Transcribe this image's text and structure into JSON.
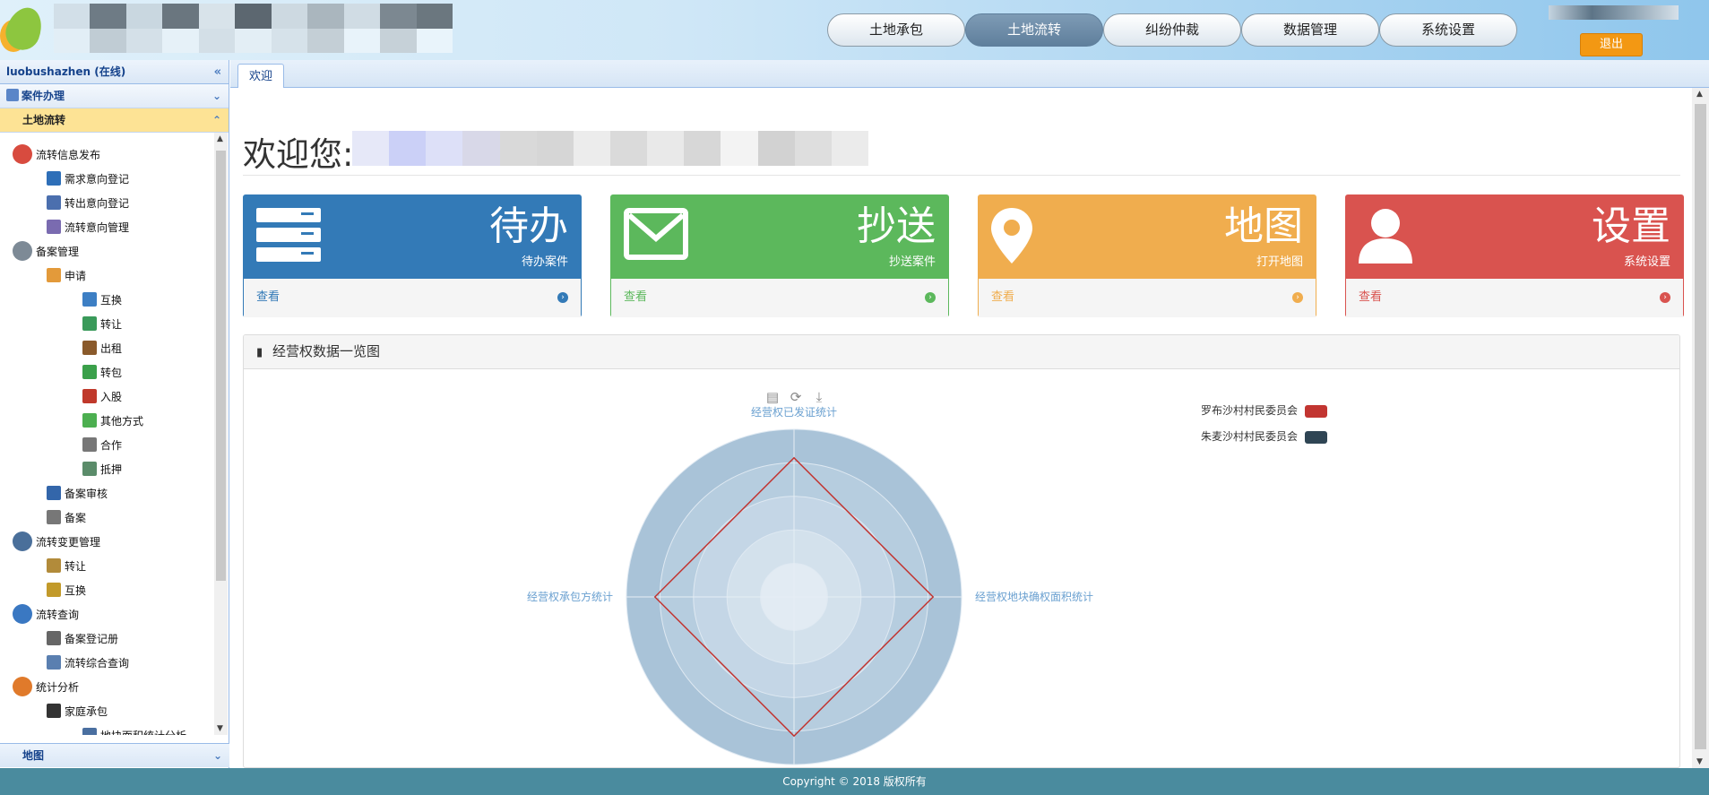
{
  "nav": {
    "items": [
      "土地承包",
      "土地流转",
      "纠纷仲裁",
      "数据管理",
      "系统设置"
    ],
    "active": 1
  },
  "header": {
    "logout_label": "退出"
  },
  "sidebar": {
    "user_label": "luobushazhen (在线)",
    "section1": "案件办理",
    "section2": "土地流转",
    "bottom": "地图",
    "tree": [
      {
        "label": "流转信息发布",
        "level": 0,
        "icon": "publish-icon",
        "color": "#d84b3f"
      },
      {
        "label": "需求意向登记",
        "level": 1,
        "icon": "arrow-left-icon",
        "color": "#2e6fb8"
      },
      {
        "label": "转出意向登记",
        "level": 1,
        "icon": "transfer-out-icon",
        "color": "#4b6fae"
      },
      {
        "label": "流转意向管理",
        "level": 1,
        "icon": "manage-icon",
        "color": "#7a6bb0"
      },
      {
        "label": "备案管理",
        "level": 0,
        "icon": "database-icon",
        "color": "#7d8a96"
      },
      {
        "label": "申请",
        "level": 1,
        "icon": "calendar-icon",
        "color": "#e39a3a"
      },
      {
        "label": "互换",
        "level": 2,
        "icon": "exchange-icon",
        "color": "#3d7fc4"
      },
      {
        "label": "转让",
        "level": 2,
        "icon": "refresh-icon",
        "color": "#3a9a5a"
      },
      {
        "label": "出租",
        "level": 2,
        "icon": "lease-icon",
        "color": "#8a5a2b"
      },
      {
        "label": "转包",
        "level": 2,
        "icon": "truck-icon",
        "color": "#3aa04a"
      },
      {
        "label": "入股",
        "level": 2,
        "icon": "book-icon",
        "color": "#c0392b"
      },
      {
        "label": "其他方式",
        "level": 2,
        "icon": "plus-icon",
        "color": "#4caf50"
      },
      {
        "label": "合作",
        "level": 2,
        "icon": "handshake-icon",
        "color": "#777777"
      },
      {
        "label": "抵押",
        "level": 2,
        "icon": "lock-icon",
        "color": "#5b8c6a"
      },
      {
        "label": "备案审核",
        "level": 1,
        "icon": "audit-icon",
        "color": "#3366aa"
      },
      {
        "label": "备案",
        "level": 1,
        "icon": "printer-icon",
        "color": "#777777"
      },
      {
        "label": "流转变更管理",
        "level": 0,
        "icon": "change-icon",
        "color": "#4a6f9a"
      },
      {
        "label": "转让",
        "level": 1,
        "icon": "table-icon",
        "color": "#b28b3a"
      },
      {
        "label": "互换",
        "level": 1,
        "icon": "list-icon",
        "color": "#c29a2a"
      },
      {
        "label": "流转查询",
        "level": 0,
        "icon": "search-icon",
        "color": "#3a78c2"
      },
      {
        "label": "备案登记册",
        "level": 1,
        "icon": "clip-icon",
        "color": "#666666"
      },
      {
        "label": "流转综合查询",
        "level": 1,
        "icon": "document-icon",
        "color": "#5a7fb0"
      },
      {
        "label": "统计分析",
        "level": 0,
        "icon": "chart-icon",
        "color": "#e07a2b"
      },
      {
        "label": "家庭承包",
        "level": 1,
        "icon": "monitor-icon",
        "color": "#333333"
      },
      {
        "label": "地块面积统计分析",
        "level": 2,
        "icon": "stats-icon",
        "color": "#4a6fa0"
      }
    ]
  },
  "tab": {
    "label": "欢迎"
  },
  "welcome": {
    "text": "欢迎您:"
  },
  "cards": [
    {
      "title": "待办",
      "subtitle": "待办案件",
      "link": "查看",
      "color": "#337ab7",
      "icon": "server-icon"
    },
    {
      "title": "抄送",
      "subtitle": "抄送案件",
      "link": "查看",
      "color": "#5cb85c",
      "icon": "envelope-icon"
    },
    {
      "title": "地图",
      "subtitle": "打开地图",
      "link": "查看",
      "color": "#f0ad4e",
      "icon": "map-pin-icon"
    },
    {
      "title": "设置",
      "subtitle": "系统设置",
      "link": "查看",
      "color": "#d9534f",
      "icon": "user-icon"
    }
  ],
  "panel": {
    "title": "经营权数据一览图"
  },
  "chart_data": {
    "type": "radar",
    "indicators": [
      "经营权已发证统计",
      "经营权地块确权面积统计",
      "经营权承包方统计"
    ],
    "series": [
      {
        "name": "罗布沙村村民委员会",
        "color": "#c23531",
        "values": [
          0.83,
          0.83,
          0.83,
          0.83
        ]
      },
      {
        "name": "朱麦沙村村民委员会",
        "color": "#2f4554",
        "values": []
      }
    ],
    "legend_position": "top-right"
  },
  "footer": {
    "text": "Copyright © 2018 版权所有"
  }
}
